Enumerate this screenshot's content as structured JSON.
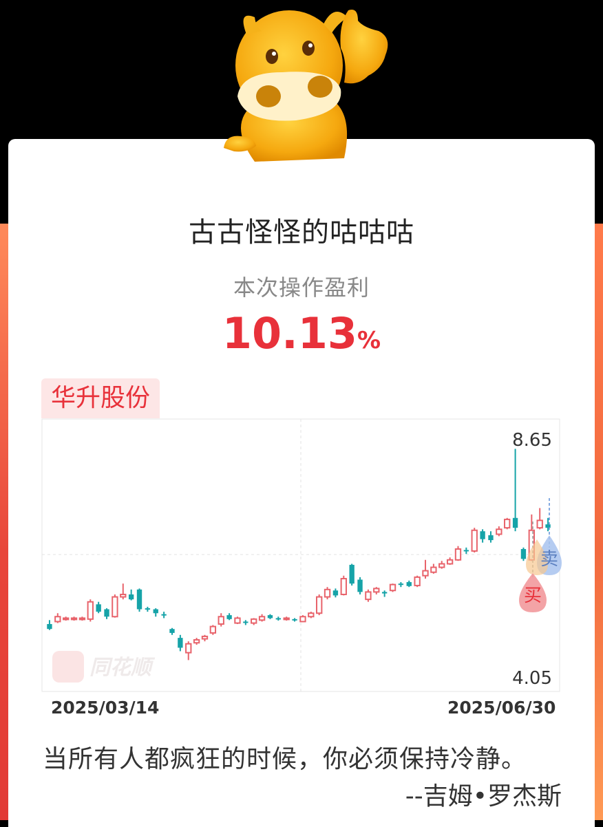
{
  "user": {
    "name": "古古怪怪的咕咕咕"
  },
  "profit": {
    "label": "本次操作盈利",
    "value": "10.13",
    "unit": "%"
  },
  "stock": {
    "name": "华升股份"
  },
  "chart_axis": {
    "high_label": "8.65",
    "low_label": "4.05",
    "date_start": "2025/03/14",
    "date_end": "2025/06/30"
  },
  "chart_markers": {
    "buy": "买",
    "sell": "卖"
  },
  "watermark": "同花顺",
  "quote": {
    "text": "当所有人都疯狂的时候，你必须保持冷静。",
    "author": "--吉姆•罗杰斯"
  },
  "colors": {
    "up": "#e8636b",
    "down": "#16a3a8",
    "accent": "#e8313a",
    "buy_marker": "#f08a8e",
    "sell_marker": "#9fb8e6"
  },
  "chart_data": {
    "type": "candlestick",
    "ylim": [
      4.05,
      8.65
    ],
    "x_range": [
      "2025/03/14",
      "2025/06/30"
    ],
    "candles": [
      [
        4.9,
        4.8,
        4.98,
        4.78
      ],
      [
        4.95,
        5.05,
        5.12,
        4.92
      ],
      [
        5.0,
        5.02,
        5.05,
        4.97
      ],
      [
        5.0,
        5.02,
        5.05,
        4.97
      ],
      [
        5.0,
        5.02,
        5.05,
        4.97
      ],
      [
        5.0,
        5.35,
        5.4,
        4.95
      ],
      [
        5.3,
        5.15,
        5.35,
        5.12
      ],
      [
        5.2,
        5.05,
        5.22,
        5.0
      ],
      [
        5.05,
        5.45,
        5.5,
        5.03
      ],
      [
        5.45,
        5.5,
        5.72,
        5.4
      ],
      [
        5.5,
        5.4,
        5.6,
        5.38
      ],
      [
        5.6,
        5.2,
        5.62,
        5.15
      ],
      [
        5.22,
        5.2,
        5.25,
        5.15
      ],
      [
        5.2,
        5.12,
        5.22,
        5.05
      ],
      [
        5.1,
        5.08,
        5.15,
        5.02
      ],
      [
        4.8,
        4.72,
        4.82,
        4.68
      ],
      [
        4.62,
        4.42,
        4.68,
        4.35
      ],
      [
        4.32,
        4.5,
        4.55,
        4.17
      ],
      [
        4.52,
        4.58,
        4.62,
        4.48
      ],
      [
        4.6,
        4.65,
        4.68,
        4.55
      ],
      [
        4.72,
        4.85,
        4.88,
        4.68
      ],
      [
        4.9,
        5.05,
        5.12,
        4.85
      ],
      [
        5.08,
        5.0,
        5.12,
        4.98
      ],
      [
        4.92,
        5.02,
        5.05,
        4.9
      ],
      [
        4.95,
        4.93,
        4.98,
        4.88
      ],
      [
        4.92,
        5.0,
        5.02,
        4.88
      ],
      [
        4.98,
        5.05,
        5.1,
        4.95
      ],
      [
        5.08,
        5.02,
        5.1,
        5.0
      ],
      [
        5.02,
        5.0,
        5.05,
        4.97
      ],
      [
        5.0,
        5.02,
        5.05,
        4.97
      ],
      [
        5.0,
        4.98,
        5.02,
        4.95
      ],
      [
        4.95,
        5.05,
        5.08,
        4.94
      ],
      [
        5.05,
        5.12,
        5.15,
        5.02
      ],
      [
        5.12,
        5.45,
        5.5,
        5.08
      ],
      [
        5.45,
        5.6,
        5.65,
        5.4
      ],
      [
        5.58,
        5.48,
        5.62,
        5.44
      ],
      [
        5.5,
        5.82,
        5.88,
        5.48
      ],
      [
        6.1,
        5.72,
        6.12,
        5.68
      ],
      [
        5.8,
        5.55,
        5.85,
        5.5
      ],
      [
        5.4,
        5.55,
        5.6,
        5.35
      ],
      [
        5.55,
        5.62,
        5.65,
        5.5
      ],
      [
        5.55,
        5.52,
        5.58,
        5.45
      ],
      [
        5.58,
        5.7,
        5.72,
        5.55
      ],
      [
        5.72,
        5.7,
        5.75,
        5.65
      ],
      [
        5.75,
        5.67,
        5.78,
        5.65
      ],
      [
        5.68,
        5.85,
        5.88,
        5.65
      ],
      [
        5.88,
        5.98,
        6.2,
        5.82
      ],
      [
        5.95,
        6.05,
        6.12,
        5.92
      ],
      [
        6.05,
        6.12,
        6.18,
        6.02
      ],
      [
        6.12,
        6.2,
        6.25,
        6.1
      ],
      [
        6.2,
        6.42,
        6.48,
        6.18
      ],
      [
        6.4,
        6.38,
        6.45,
        6.32
      ],
      [
        6.38,
        6.8,
        6.85,
        6.35
      ],
      [
        6.78,
        6.62,
        6.82,
        6.55
      ],
      [
        6.7,
        6.6,
        6.78,
        6.55
      ],
      [
        6.72,
        6.82,
        6.88,
        6.68
      ],
      [
        6.85,
        7.02,
        7.05,
        6.82
      ],
      [
        7.05,
        6.85,
        8.45,
        6.78
      ],
      [
        6.42,
        6.22,
        6.45,
        6.18
      ],
      [
        6.2,
        6.8,
        7.12,
        6.18
      ],
      [
        6.85,
        7.0,
        7.25,
        6.82
      ],
      [
        6.92,
        6.85,
        7.05,
        6.78
      ]
    ]
  }
}
